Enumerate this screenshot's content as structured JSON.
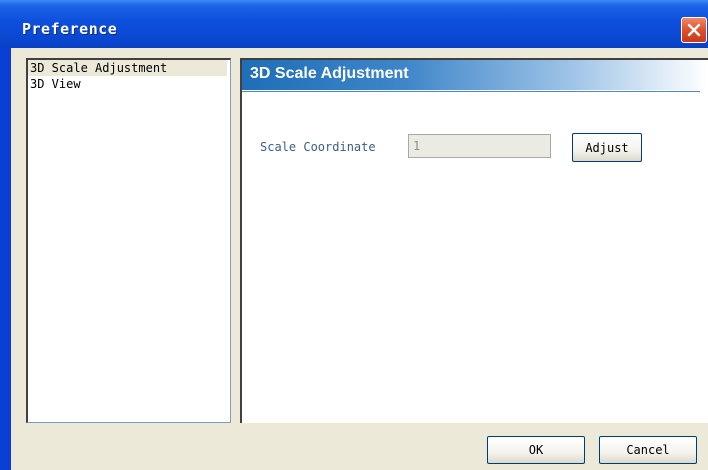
{
  "window": {
    "title": "Preference"
  },
  "sidebar": {
    "items": [
      {
        "label": "3D Scale Adjustment",
        "selected": true
      },
      {
        "label": "3D View",
        "selected": false
      }
    ]
  },
  "panel": {
    "title": "3D Scale Adjustment",
    "field": {
      "label": "Scale Coordinate",
      "value": "1"
    },
    "adjust_label": "Adjust"
  },
  "footer": {
    "ok_label": "OK",
    "cancel_label": "Cancel"
  },
  "colors": {
    "titlebar": "#0a48d2",
    "client_bg": "#ece9d8",
    "header_blue": "#1e6eb8",
    "close_red": "#e0502a"
  },
  "icons": {
    "close": "close-icon"
  }
}
